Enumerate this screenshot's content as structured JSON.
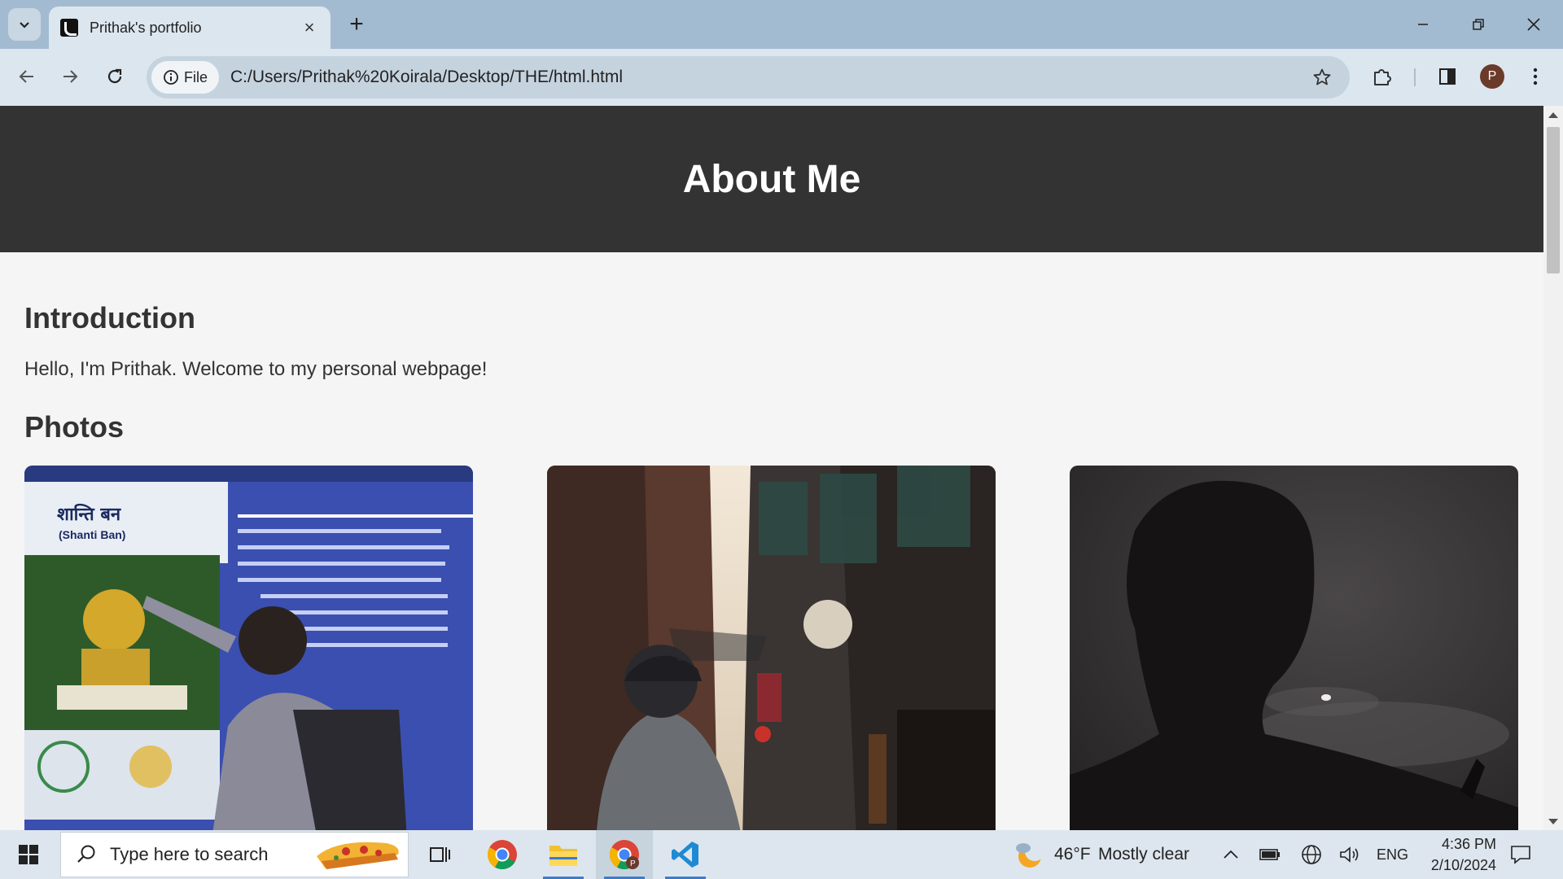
{
  "browser": {
    "tab_title": "Prithak's portfolio",
    "new_tab_label": "+",
    "site_info_label": "File",
    "url": "C:/Users/Prithak%20Koirala/Desktop/THE/html.html",
    "profile_initial": "P",
    "accent_color": "#a3bbd0"
  },
  "page": {
    "header_title": "About Me",
    "intro_heading": "Introduction",
    "intro_text": "Hello, I'm Prithak. Welcome to my personal webpage!",
    "photos_heading": "Photos",
    "photos": [
      {
        "sign_title": "शान्ति बन",
        "sign_subtitle": "(Shanti Ban)"
      },
      {},
      {}
    ]
  },
  "taskbar": {
    "search_placeholder": "Type here to search",
    "weather_temp": "46°F",
    "weather_text": "Mostly clear",
    "language": "ENG",
    "time": "4:36 PM",
    "date": "2/10/2024"
  }
}
